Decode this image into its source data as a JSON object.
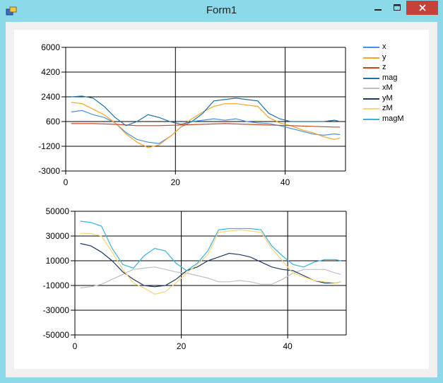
{
  "window": {
    "title": "Form1",
    "controls": {
      "minimize": "minimize",
      "maximize": "maximize",
      "close": "close"
    }
  },
  "colors": {
    "x": "#4a90e2",
    "y": "#f5a623",
    "z": "#d0441c",
    "mag": "#1f6fa8",
    "xM": "#c0c0c0",
    "yM": "#1c3a66",
    "zM": "#fcd37a",
    "magM": "#36b4e0",
    "grid": "#000000",
    "close_button": "#c7403a"
  },
  "legend": [
    {
      "key": "x",
      "label": "x"
    },
    {
      "key": "y",
      "label": "y"
    },
    {
      "key": "z",
      "label": "z"
    },
    {
      "key": "mag",
      "label": "mag"
    },
    {
      "key": "xM",
      "label": "xM"
    },
    {
      "key": "yM",
      "label": "yM"
    },
    {
      "key": "zM",
      "label": "zM"
    },
    {
      "key": "magM",
      "label": "magM"
    }
  ],
  "chart_data": [
    {
      "type": "line",
      "xlim": [
        0,
        51
      ],
      "ylim": [
        -3000,
        6000
      ],
      "xticks": [
        0,
        20,
        40
      ],
      "yticks": [
        6000,
        4200,
        2400,
        600,
        -1200,
        -3000
      ],
      "series": [
        {
          "name": "x",
          "key": "x",
          "x": [
            1,
            3,
            5,
            7,
            9,
            11,
            13,
            15,
            17,
            19,
            21,
            23,
            25,
            27,
            29,
            31,
            33,
            35,
            37,
            39,
            41,
            43,
            45,
            47,
            49,
            50
          ],
          "values": [
            1300,
            1400,
            1100,
            900,
            500,
            -200,
            -700,
            -900,
            -1000,
            -500,
            200,
            600,
            700,
            800,
            700,
            800,
            600,
            500,
            450,
            300,
            100,
            -100,
            -300,
            -400,
            -300,
            -350
          ]
        },
        {
          "name": "y",
          "key": "y",
          "x": [
            1,
            3,
            5,
            7,
            9,
            11,
            13,
            15,
            17,
            19,
            21,
            23,
            25,
            27,
            29,
            31,
            33,
            35,
            37,
            39,
            41,
            43,
            45,
            47,
            49,
            50
          ],
          "values": [
            2000,
            1900,
            1500,
            1100,
            500,
            -300,
            -900,
            -1300,
            -1100,
            -500,
            200,
            800,
            1300,
            1700,
            1900,
            1900,
            1800,
            1700,
            900,
            500,
            300,
            0,
            -200,
            -500,
            -700,
            -600
          ]
        },
        {
          "name": "z",
          "key": "z",
          "x": [
            1,
            5,
            9,
            13,
            17,
            21,
            25,
            29,
            33,
            37,
            41,
            45,
            49,
            50
          ],
          "values": [
            450,
            450,
            400,
            300,
            300,
            350,
            400,
            450,
            400,
            350,
            300,
            250,
            200,
            200
          ]
        },
        {
          "name": "mag",
          "key": "mag",
          "x": [
            1,
            3,
            5,
            7,
            9,
            11,
            13,
            15,
            17,
            19,
            21,
            23,
            25,
            27,
            29,
            31,
            33,
            35,
            37,
            39,
            41,
            43,
            45,
            47,
            49,
            50
          ],
          "values": [
            2400,
            2450,
            2300,
            1700,
            900,
            300,
            600,
            1100,
            900,
            600,
            400,
            600,
            1200,
            2100,
            2200,
            2300,
            2200,
            2100,
            1200,
            800,
            600,
            600,
            600,
            600,
            700,
            600
          ]
        },
        {
          "name": "xM",
          "key": "xM",
          "x": [],
          "values": []
        },
        {
          "name": "yM",
          "key": "yM",
          "x": [],
          "values": []
        },
        {
          "name": "zM",
          "key": "zM",
          "x": [],
          "values": []
        },
        {
          "name": "magM",
          "key": "magM",
          "x": [],
          "values": []
        }
      ]
    },
    {
      "type": "line",
      "xlim": [
        0,
        51
      ],
      "ylim": [
        -50000,
        50000
      ],
      "xticks": [
        0,
        20,
        40
      ],
      "yticks": [
        50000,
        30000,
        10000,
        -10000,
        -30000,
        -50000
      ],
      "series": [
        {
          "name": "x",
          "key": "x",
          "x": [],
          "values": []
        },
        {
          "name": "y",
          "key": "y",
          "x": [],
          "values": []
        },
        {
          "name": "z",
          "key": "z",
          "x": [],
          "values": []
        },
        {
          "name": "mag",
          "key": "mag",
          "x": [],
          "values": []
        },
        {
          "name": "xM",
          "key": "xM",
          "x": [
            1,
            3,
            5,
            7,
            9,
            11,
            13,
            15,
            17,
            19,
            21,
            23,
            25,
            27,
            29,
            31,
            33,
            35,
            37,
            39,
            41,
            43,
            45,
            47,
            49,
            50
          ],
          "values": [
            -12000,
            -11000,
            -9000,
            -5000,
            -1000,
            3000,
            4000,
            5000,
            3000,
            1000,
            0,
            -2000,
            -4000,
            -7000,
            -7000,
            -6000,
            -7000,
            -9000,
            -9000,
            -5000,
            0,
            3000,
            3000,
            3000,
            0,
            -1000
          ]
        },
        {
          "name": "yM",
          "key": "yM",
          "x": [
            1,
            3,
            5,
            7,
            9,
            11,
            13,
            15,
            17,
            19,
            21,
            23,
            25,
            27,
            29,
            31,
            33,
            35,
            37,
            39,
            41,
            43,
            45,
            47,
            49,
            50
          ],
          "values": [
            24000,
            22000,
            17000,
            10000,
            1000,
            -5000,
            -10000,
            -11000,
            -10000,
            -5000,
            2000,
            5000,
            10000,
            13000,
            16000,
            15000,
            13000,
            9000,
            5000,
            3000,
            2000,
            -2000,
            -6000,
            -8000,
            -8000,
            -7000
          ]
        },
        {
          "name": "zM",
          "key": "zM",
          "x": [
            1,
            3,
            5,
            7,
            9,
            11,
            13,
            15,
            17,
            19,
            21,
            23,
            25,
            27,
            29,
            31,
            33,
            35,
            37,
            39,
            41,
            43,
            45,
            47,
            49,
            50
          ],
          "values": [
            32000,
            32000,
            30000,
            17000,
            3000,
            -8000,
            -12000,
            -17000,
            -15000,
            -8000,
            0,
            7000,
            15000,
            33000,
            34000,
            35000,
            34000,
            33000,
            20000,
            10000,
            0,
            -3000,
            -6000,
            -7000,
            -8000,
            -7000
          ]
        },
        {
          "name": "magM",
          "key": "magM",
          "x": [
            1,
            3,
            5,
            7,
            9,
            11,
            13,
            15,
            17,
            19,
            21,
            23,
            25,
            27,
            29,
            31,
            33,
            35,
            37,
            39,
            41,
            43,
            45,
            47,
            49,
            50
          ],
          "values": [
            42000,
            41000,
            38000,
            20000,
            7000,
            4000,
            14000,
            20000,
            18000,
            8000,
            2000,
            8000,
            18000,
            35000,
            36000,
            36000,
            36000,
            35000,
            22000,
            14000,
            7000,
            5000,
            9000,
            11000,
            11000,
            10000
          ]
        }
      ]
    }
  ]
}
